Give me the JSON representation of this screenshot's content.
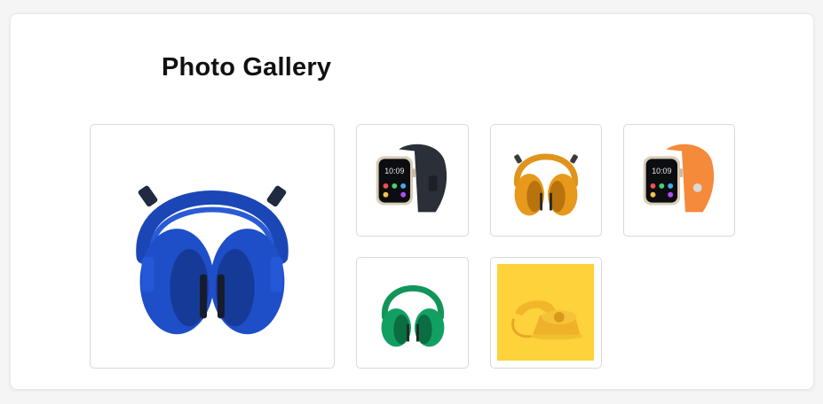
{
  "gallery": {
    "title": "Photo Gallery",
    "main_image": {
      "subject": "blue headphones",
      "color": "#1f4fc4"
    },
    "thumbnails": [
      {
        "subject": "smartwatch with dark band",
        "band_color": "#2b2f38",
        "time": "10:09"
      },
      {
        "subject": "orange headphones",
        "color": "#e29a16"
      },
      {
        "subject": "smartwatch with orange band",
        "band_color": "#f58a3a",
        "time": "10:09"
      },
      {
        "subject": "green headphones",
        "color": "#109a5c"
      },
      {
        "subject": "yellow rotary telephone",
        "background": "#fdd23b"
      }
    ]
  }
}
